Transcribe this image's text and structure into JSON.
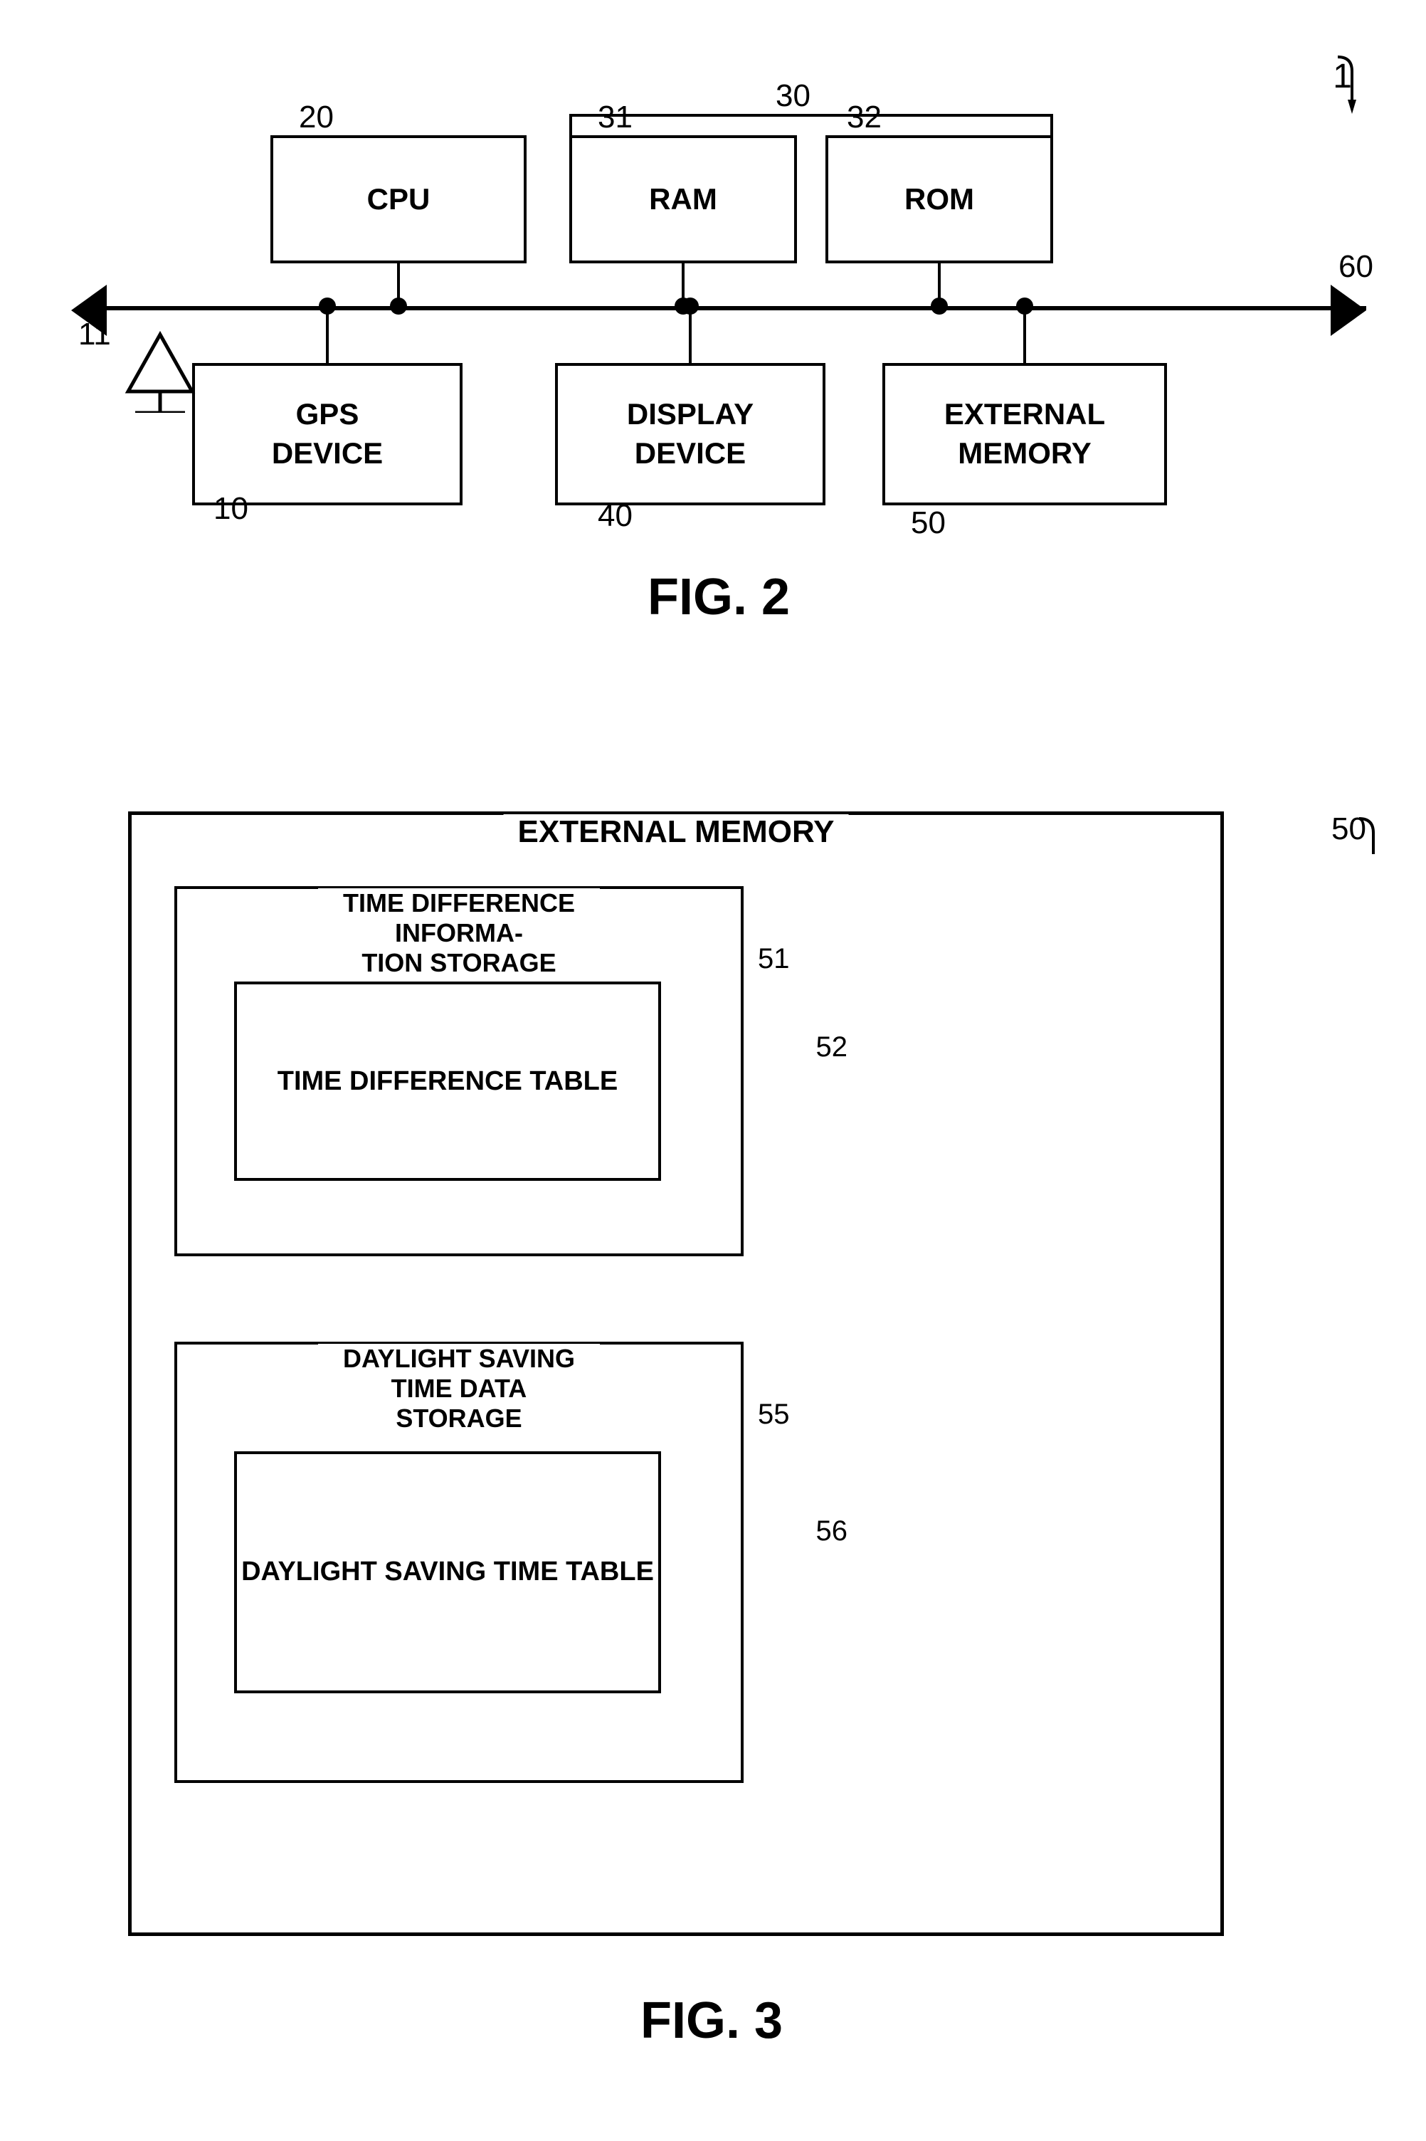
{
  "fig2": {
    "title": "FIG. 2",
    "ref_1": "1",
    "ref_60": "60",
    "components": {
      "cpu": {
        "label": "CPU",
        "ref": "20"
      },
      "ram": {
        "label": "RAM",
        "ref": "31"
      },
      "rom": {
        "label": "ROM",
        "ref": "32"
      },
      "gps": {
        "label": "GPS\nDEVICE",
        "ref": "10"
      },
      "display": {
        "label": "DISPLAY\nDEVICE",
        "ref": "40"
      },
      "extmem": {
        "label": "EXTERNAL\nMEMORY",
        "ref": "50"
      },
      "bracket_ref": "30",
      "antenna_ref": "11"
    }
  },
  "fig3": {
    "title": "FIG. 3",
    "ref_50": "50",
    "outer_label": "EXTERNAL MEMORY",
    "box1_label": "TIME DIFFERENCE INFORMA-\nTION STORAGE",
    "box1_ref": "51",
    "box2_label": "TIME DIFFERENCE TABLE",
    "box2_ref": "52",
    "box3_label": "DAYLIGHT SAVING TIME DATA\nSTORAGE",
    "box3_ref": "55",
    "box4_label": "DAYLIGHT SAVING\nTIME TABLE",
    "box4_ref": "56"
  }
}
